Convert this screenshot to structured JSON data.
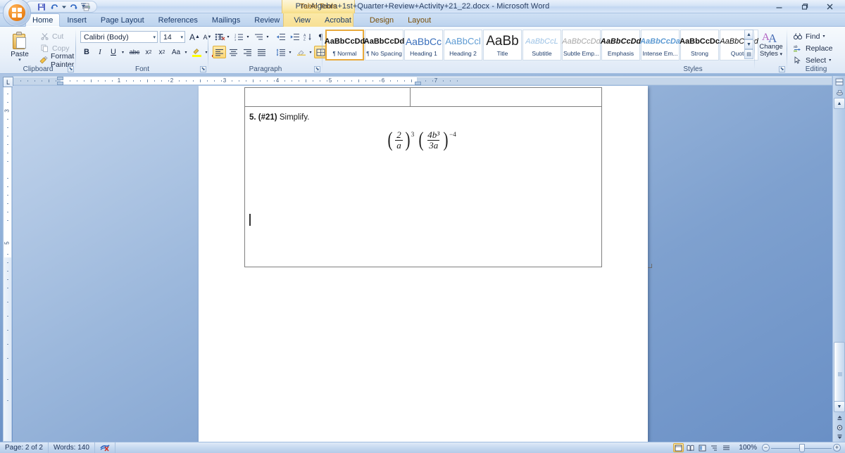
{
  "window": {
    "document_title": "Pre-Algebra+1st+Quarter+Review+Activity+21_22.docx - Microsoft Word",
    "contextual_group": "Table Tools",
    "minimize": "minimize-icon",
    "restore": "restore-icon",
    "close": "close-icon"
  },
  "quick_access": {
    "save": "save-icon",
    "undo": "undo-icon",
    "redo": "redo-icon",
    "print_preview": "print-icon",
    "customize": "customize-icon"
  },
  "tabs": [
    {
      "label": "Home",
      "active": true
    },
    {
      "label": "Insert",
      "active": false
    },
    {
      "label": "Page Layout",
      "active": false
    },
    {
      "label": "References",
      "active": false
    },
    {
      "label": "Mailings",
      "active": false
    },
    {
      "label": "Review",
      "active": false
    },
    {
      "label": "View",
      "active": false
    },
    {
      "label": "Acrobat",
      "active": false
    },
    {
      "label": "Design",
      "active": false
    },
    {
      "label": "Layout",
      "active": false
    }
  ],
  "ribbon": {
    "clipboard": {
      "group_label": "Clipboard",
      "paste": "Paste",
      "cut": "Cut",
      "copy": "Copy",
      "format_painter": "Format Painter"
    },
    "font": {
      "group_label": "Font",
      "font_name": "Calibri (Body)",
      "font_size": "14",
      "grow_font": "A",
      "shrink_font": "A",
      "clear_formatting": "clear-formatting-icon",
      "bold": "B",
      "italic": "I",
      "underline": "U",
      "strikethrough": "abc",
      "subscript": "x",
      "superscript": "x",
      "change_case": "Aa",
      "text_highlight": "highlight-icon",
      "font_color": "A"
    },
    "paragraph": {
      "group_label": "Paragraph",
      "bullets": "bullets-icon",
      "numbering": "numbering-icon",
      "multilevel_list": "multilevel-list-icon",
      "decrease_indent": "decrease-indent-icon",
      "increase_indent": "increase-indent-icon",
      "sort": "sort-icon",
      "show_marks": "¶",
      "align_left": "align-left-icon",
      "align_center": "align-center-icon",
      "align_right": "align-right-icon",
      "justify": "justify-icon",
      "line_spacing": "line-spacing-icon",
      "shading": "shading-icon",
      "borders": "borders-icon"
    },
    "styles": {
      "group_label": "Styles",
      "items": [
        {
          "preview": "AaBbCcDd",
          "name": "Normal",
          "pilcrow": true,
          "selected": true
        },
        {
          "preview": "AaBbCcDd",
          "name": "No Spacing",
          "pilcrow": true,
          "selected": false
        },
        {
          "preview": "AaBbCc",
          "name": "Heading 1",
          "pilcrow": false,
          "selected": false
        },
        {
          "preview": "AaBbCcl",
          "name": "Heading 2",
          "pilcrow": false,
          "selected": false
        },
        {
          "preview": "AaBb",
          "name": "Title",
          "pilcrow": false,
          "selected": false
        },
        {
          "preview": "AaBbCcL",
          "name": "Subtitle",
          "pilcrow": false,
          "selected": false
        },
        {
          "preview": "AaBbCcDd",
          "name": "Subtle Emp...",
          "pilcrow": false,
          "selected": false
        },
        {
          "preview": "AaBbCcDd",
          "name": "Emphasis",
          "pilcrow": false,
          "selected": false
        },
        {
          "preview": "AaBbCcDa",
          "name": "Intense Em...",
          "pilcrow": false,
          "selected": false
        },
        {
          "preview": "AaBbCcDc",
          "name": "Strong",
          "pilcrow": false,
          "selected": false
        },
        {
          "preview": "AaBbCcDd",
          "name": "Quote",
          "pilcrow": false,
          "selected": false
        }
      ],
      "change_styles": "Change Styles"
    },
    "editing": {
      "group_label": "Editing",
      "find": "Find",
      "replace": "Replace",
      "select": "Select"
    }
  },
  "ruler": {
    "horizontal_numbers": [
      "1",
      "2",
      "3",
      "4",
      "5",
      "6",
      "7"
    ],
    "vertical_numbers": [
      "3",
      "5"
    ],
    "tab_selector": "L"
  },
  "document": {
    "question_number": "5. (#21)",
    "question_text": "Simplify.",
    "expression": {
      "group1": {
        "numerator": "2",
        "denominator": "a",
        "exponent": "3"
      },
      "group2": {
        "numerator": "4b³",
        "denominator": "3a",
        "exponent": "−4"
      }
    }
  },
  "status_bar": {
    "page": "Page: 2 of 2",
    "words": "Words: 140",
    "proofing": "spell-check-icon",
    "zoom_level": "100%",
    "views": [
      {
        "name": "print-layout-view",
        "active": true
      },
      {
        "name": "full-screen-reading-view",
        "active": false
      },
      {
        "name": "web-layout-view",
        "active": false
      },
      {
        "name": "outline-view",
        "active": false
      },
      {
        "name": "draft-view",
        "active": false
      }
    ],
    "zoom_out": "−",
    "zoom_in": "+"
  },
  "colors": {
    "accent": "#1b3b6b",
    "contextual_tab": "#f7df94",
    "selection": "#e9a93a"
  }
}
